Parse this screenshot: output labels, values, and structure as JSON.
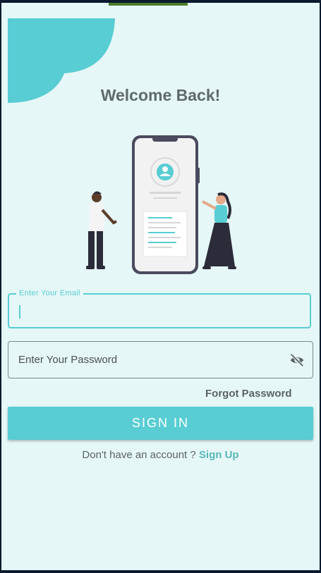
{
  "theme": {
    "accent": "#58cdd3",
    "background": "#e6f7f7",
    "status_accent": "#4c7d2a"
  },
  "header": {
    "title": "Welcome Back!"
  },
  "form": {
    "email_label": "Enter Your Email",
    "email_value": "",
    "password_placeholder": "Enter Your Password",
    "password_value": "",
    "password_toggle_icon": "eye-off-icon",
    "forgot_label": "Forgot Password",
    "signin_label": "SIGN IN"
  },
  "footer": {
    "prompt": "Don't have an account ?",
    "signup_label": "Sign Up"
  }
}
